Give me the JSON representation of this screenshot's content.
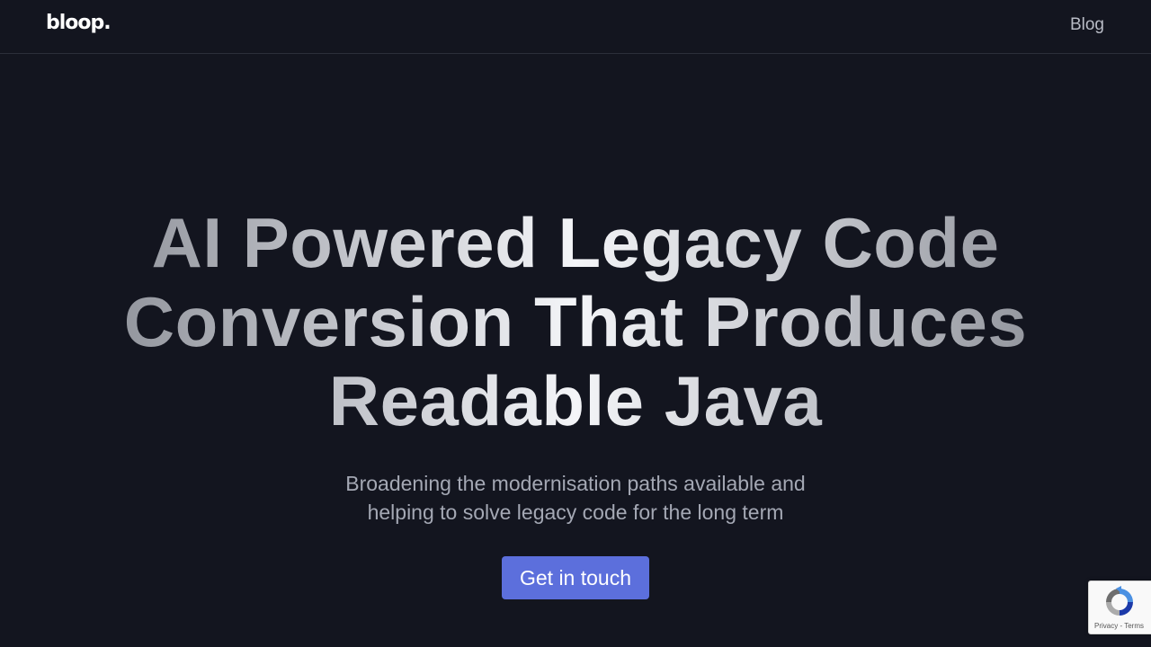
{
  "header": {
    "logo_text": "bloop.",
    "nav": {
      "blog_label": "Blog"
    }
  },
  "hero": {
    "title_lines": [
      "AI Powered Legacy Code",
      "Conversion That Produces",
      "Readable Java"
    ],
    "subtitle_lines": [
      "Broadening the modernisation paths available and",
      "helping to solve legacy code for the long term"
    ],
    "cta_label": "Get in touch"
  },
  "recaptcha": {
    "icon": "recaptcha-icon",
    "privacy_label": "Privacy",
    "separator": " - ",
    "terms_label": "Terms"
  },
  "colors": {
    "background": "#13151f",
    "accent": "#5c6fdc",
    "subtitle": "#a4a8b4",
    "nav_link": "#b9bcc6"
  }
}
